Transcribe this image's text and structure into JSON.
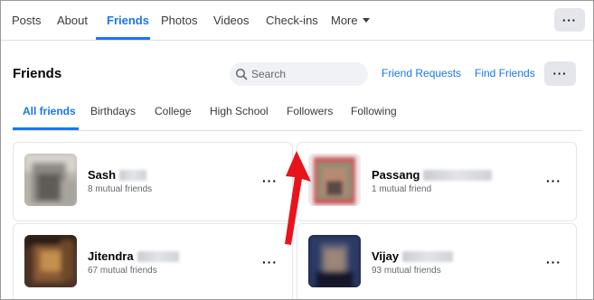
{
  "top_tabs": [
    {
      "label": "Posts"
    },
    {
      "label": "About"
    },
    {
      "label": "Friends"
    },
    {
      "label": "Photos"
    },
    {
      "label": "Videos"
    },
    {
      "label": "Check-ins"
    },
    {
      "label": "More"
    }
  ],
  "top_more_button": "···",
  "friends_panel": {
    "title": "Friends",
    "search_placeholder": "Search",
    "friend_requests": "Friend Requests",
    "find_friends": "Find Friends",
    "more_button": "···"
  },
  "sub_tabs": [
    {
      "label": "All friends"
    },
    {
      "label": "Birthdays"
    },
    {
      "label": "College"
    },
    {
      "label": "High School"
    },
    {
      "label": "Followers"
    },
    {
      "label": "Following"
    }
  ],
  "friends": [
    {
      "name": "Sash",
      "mutual": "8 mutual friends",
      "menu": "···"
    },
    {
      "name": "Passang",
      "mutual": "1 mutual friend",
      "menu": "···"
    },
    {
      "name": "Jitendra",
      "mutual": "67 mutual friends",
      "menu": "···"
    },
    {
      "name": "Vijay",
      "mutual": "93 mutual friends",
      "menu": "···"
    }
  ],
  "colors": {
    "accent": "#1877f2",
    "annotation_arrow": "#e8141a"
  },
  "icons": [
    "search-icon",
    "chevron-down-icon",
    "annotation-arrow"
  ]
}
